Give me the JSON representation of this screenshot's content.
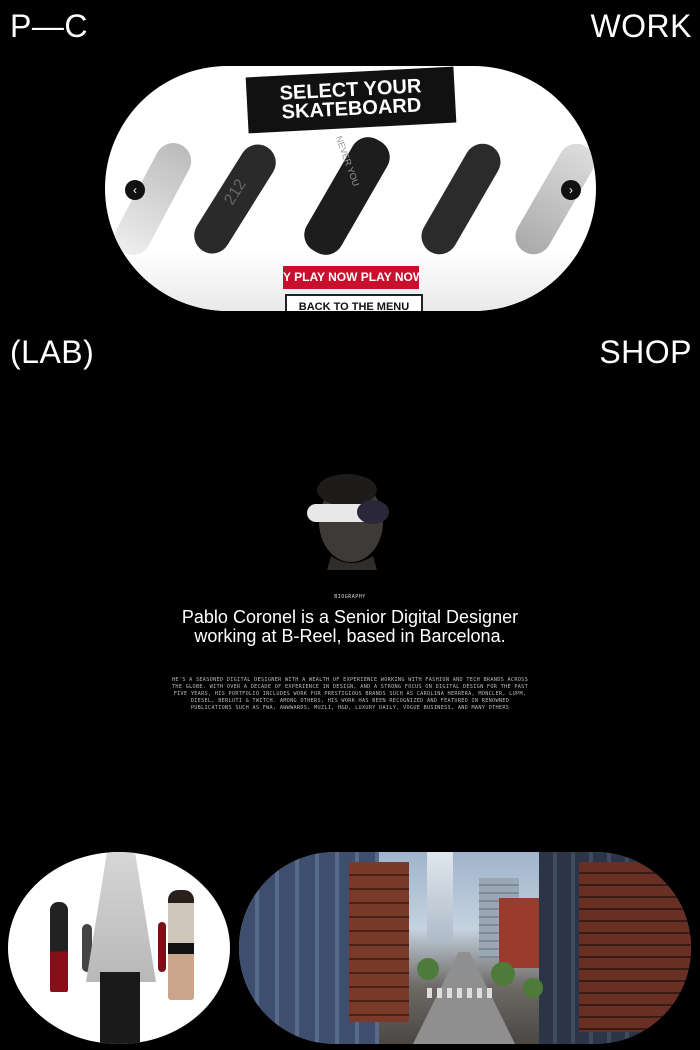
{
  "nav": {
    "logo": "P—C",
    "work": "WORK",
    "lab": "(LAB)",
    "shop": "SHOP"
  },
  "skateboard_card": {
    "title_line1": "SELECT YOUR",
    "title_line2": "SKATEBOARD",
    "play_label": "Y PLAY NOW PLAY NOW",
    "back_label": "BACK TO THE MENU",
    "prev_icon": "chevron-left-icon",
    "next_icon": "chevron-right-icon",
    "board_graphic_text": "212",
    "board_ring_text": "NEVER YOU"
  },
  "bio": {
    "label": "BIOGRAPHY",
    "headline": "Pablo Coronel is a Senior Digital Designer working at B-Reel, based in Barcelona.",
    "body": "He's a seasoned digital designer with a wealth of experience working with fashion and tech brands across the globe. With over a decade of experience in design, and a strong focus on digital design for the past five years, his portfolio includes work for prestigious brands such as Carolina Herrera, Moncler, Lupm, Diesel, Berluti & Twitch. Among others, his work has been recognized and featured in renowned publications such as FWA, Awwwards, Muzli, H&D, Luxury Daily, Vogue Business, and many others"
  },
  "colors": {
    "background": "#000000",
    "text": "#ffffff",
    "play_red": "#c8102e"
  }
}
